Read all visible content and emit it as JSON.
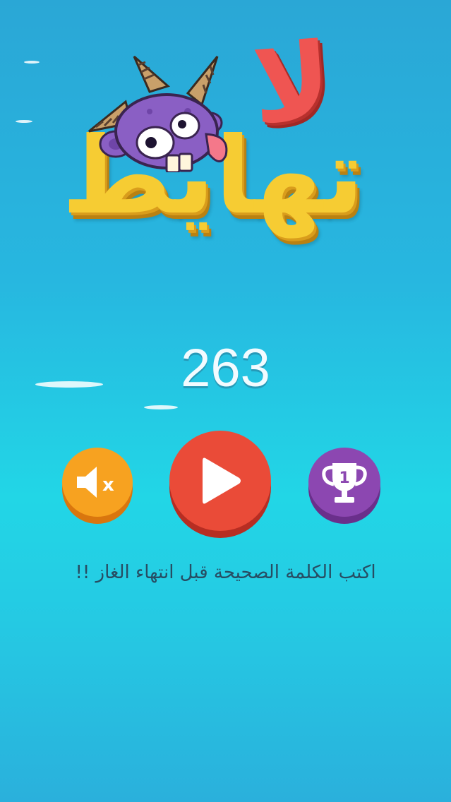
{
  "logo": {
    "line1": "لا",
    "line2": "تهايط"
  },
  "score": "263",
  "buttons": {
    "sound": {
      "icon": "mute-icon",
      "mark": "x"
    },
    "play": {
      "icon": "play-icon"
    },
    "leaderboard": {
      "icon": "trophy-icon",
      "rank": "1"
    }
  },
  "tagline": "اكتب الكلمة الصحيحة قبل انتهاء الغاز !!",
  "colors": {
    "sky_top": "#2aa7d6",
    "sky_mid": "#22d6e6",
    "logo_red": "#ef5552",
    "logo_yellow": "#f6cc33",
    "sound_orange": "#f7a220",
    "play_red": "#ea4b38",
    "trophy_purple": "#8c47b1",
    "monster_purple": "#8a5fc4"
  }
}
